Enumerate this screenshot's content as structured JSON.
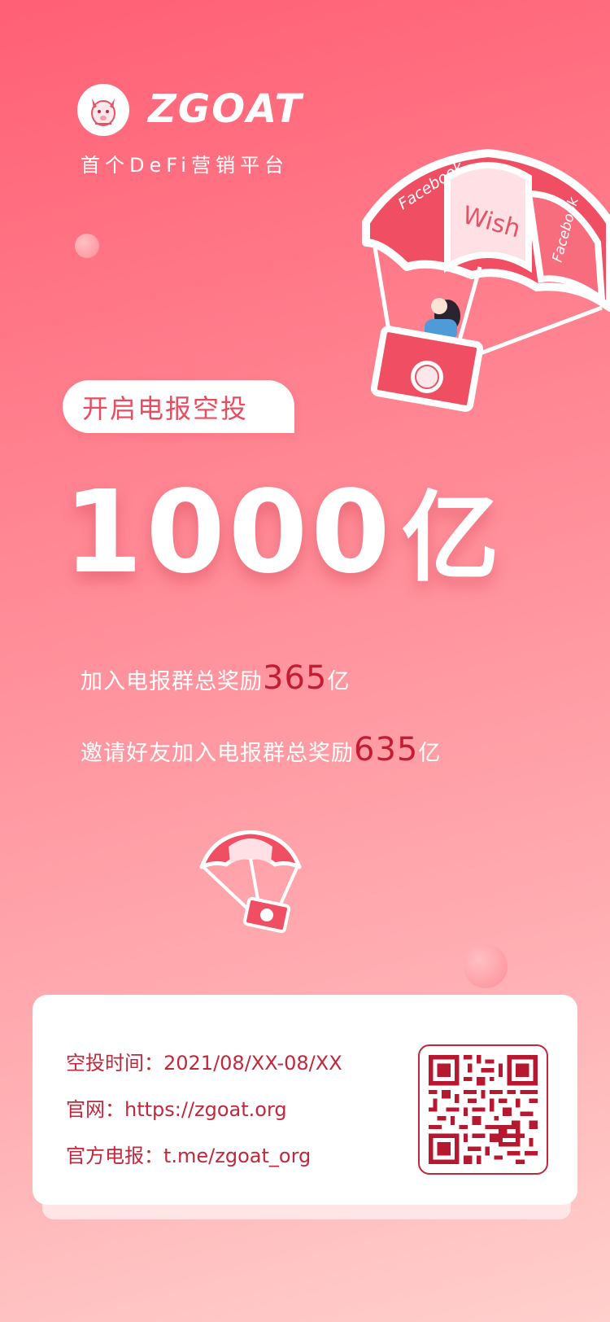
{
  "brand": {
    "name": "ZGOAT",
    "tagline": "首个DeFi营销平台"
  },
  "banner": {
    "title": "开启电报空投"
  },
  "amount": {
    "value": "1000",
    "unit": "亿"
  },
  "rewards": [
    {
      "prefix": "加入电报群总奖励",
      "number": "365",
      "suffix": "亿"
    },
    {
      "prefix": "邀请好友加入电报群总奖励",
      "number": "635",
      "suffix": "亿"
    }
  ],
  "parachute": {
    "panel_left": "Facebook",
    "panel_center": "Wish",
    "panel_right": "Facebook"
  },
  "info": {
    "time_label": "空投时间：",
    "time_value": "2021/08/XX-08/XX",
    "site_label": "官网：",
    "site_value": "https://zgoat.org",
    "tg_label": "官方电报：",
    "tg_value": "t.me/zgoat_org"
  },
  "icons": [
    "goat-logo-icon",
    "parachute-icon",
    "qr-code-icon"
  ],
  "colors": {
    "accent": "#c0283c",
    "primary_pink": "#ff6b7d"
  }
}
